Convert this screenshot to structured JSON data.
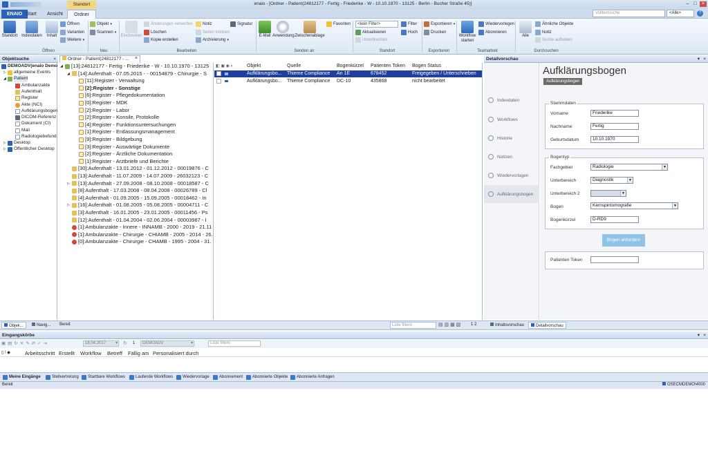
{
  "window": {
    "title": "enaio - [Ordner - Patient(24812177 - Fertig - Friederike - W - 10.10.1970 - 13125 - Berlin - Bucher Straße 45)]",
    "context_tab": "Standort",
    "search_placeholder": "Volltextsuche",
    "scope": "<Alle>"
  },
  "ribbon": {
    "tabs": [
      {
        "label": "ENAIO"
      },
      {
        "label": "Start"
      },
      {
        "label": "Ansicht"
      },
      {
        "label": "Ordner"
      }
    ],
    "groups": {
      "oeffnen": "Öffnen",
      "neu": "Neu",
      "bearbeiten": "Bearbeiten",
      "senden": "Senden an",
      "standort": "Standort",
      "exportieren": "Exportieren",
      "teamarbeit": "Teamarbeit",
      "durchsuchen": "Durchsuchen"
    },
    "btn": {
      "standort": "Standort",
      "indexdaten": "Indexdaten",
      "inhalt": "Inhalt",
      "oeffnen": "Öffnen",
      "varianten": "Varianten",
      "weitere": "Weitere",
      "objekt": "Objekt",
      "scannen": "Scannen",
      "einchecken": "Einchecken",
      "aenderungen": "Änderungen verwerfen",
      "loeschen": "Löschen",
      "kopie": "Kopie erstellen",
      "notiz": "Notiz",
      "seiten": "Seiten trennen",
      "archivierung": "Archivierung",
      "signatur": "Signatur",
      "email": "E-Mail",
      "anwendung": "Anwendung",
      "zwischenablage": "Zwischenablage",
      "favoriten": "Favoriten",
      "filter_combo": "<kein Filter>",
      "aktualisieren": "Aktualisieren",
      "unterbrechen": "Unterbrechen",
      "filter": "Filter",
      "hoch": "Hoch",
      "exportieren": "Exportieren",
      "drucken": "Drucken",
      "workflow": "Workflow starten",
      "wiedervorlegen": "Wiedervorlegen",
      "abonnieren": "Abonnieren",
      "alle": "Alle",
      "aehnliche": "Ähnliche Objekte",
      "notiz2": "Notiz",
      "suche": "Suche aufheben"
    }
  },
  "objektsuche": {
    "title": "Objektsuche",
    "items": [
      {
        "label": "DEMOADV(enaio Demo"
      },
      {
        "label": "allgemeine Events"
      },
      {
        "label": "Patient"
      },
      {
        "label": "Ambulanzakte"
      },
      {
        "label": "Aufenthalt"
      },
      {
        "label": "Register"
      },
      {
        "label": "Akte (NCI)"
      },
      {
        "label": "Aufklärungsbogen"
      },
      {
        "label": "DICOM-Referenz"
      },
      {
        "label": "Dokument (CI)"
      },
      {
        "label": "Mail"
      },
      {
        "label": "Radiologiebefund"
      },
      {
        "label": "Desktop"
      },
      {
        "label": "Öffentlicher Desktop"
      }
    ]
  },
  "folder": {
    "title": "Ordner - Patient(24812177 - ...",
    "rows": [
      {
        "label": "[13]:24812177 - Fertig - Friederike - W - 10.10.1970 - 13125"
      },
      {
        "label": "[14]:Aufenthalt - 07.05.2015 - - 00154879 - Chirurgie - S"
      },
      {
        "label": "[11]:Register - Verwaltung"
      },
      {
        "label": "[2]:Register - Sonstige"
      },
      {
        "label": "[6]:Register - Pflegedokumentation"
      },
      {
        "label": "[0]:Register - MDK"
      },
      {
        "label": "[2]:Register - Labor"
      },
      {
        "label": "[2]:Register - Konsile, Protokolle"
      },
      {
        "label": "[4]:Register - Funktionsuntersuchungen"
      },
      {
        "label": "[1]:Register - Entlassungsmanagement"
      },
      {
        "label": "[9]:Register - Bildgebung"
      },
      {
        "label": "[3]:Register - Auswärtige Dokumente"
      },
      {
        "label": "[2]:Register - Ärztliche Dokumentation"
      },
      {
        "label": "[1]:Register - Arztbriefe und Berichte"
      },
      {
        "label": "[30]:Aufenthalt - 13.01.2012 - 01.12.2012 - 00019876 - C"
      },
      {
        "label": "[13]:Aufenthalt - 11.07.2009 - 14.07.2009 - 26032123 - C"
      },
      {
        "label": "[13]:Aufenthalt - 27.09.2008 - 08.10.2008 - 00018587 - C"
      },
      {
        "label": "[8]:Aufenthalt - 17.03.2008 - 08.04.2008 - 00026789 - Cl"
      },
      {
        "label": "[4]:Aufenthalt - 01.09.2005 - 15.09.2005 - 00018462 - In"
      },
      {
        "label": "[16]:Aufenthalt - 01.08.2005 - 05.08.2005 - 00004711 - C"
      },
      {
        "label": "[3]:Aufenthalt - 16.01.2005 - 23.01.2005 - 00011456 - Ps"
      },
      {
        "label": "[12]:Aufenthalt - 01.04.2004 - 02.06.2004 - 00003987 - I"
      },
      {
        "label": "[1]:Ambulanzakte - Innere - INNAMB - 2000 - 2019 - 21.11"
      },
      {
        "label": "[1]:Ambulanzakte - Chirurgie - CHIAMB - 2005 - 2014 - 26."
      },
      {
        "label": "[0]:Ambulanzakte - Chirurgie - CHAMB - 1995 - 2004 - 31."
      }
    ]
  },
  "table": {
    "headers": [
      "Objekt",
      "Quelle",
      "Bogenkürzel",
      "Patienten Token",
      "Bogen Status"
    ],
    "rows": [
      [
        "Aufklärungsbo...",
        "Thieme Compliance",
        "An 1E",
        "678452",
        "Freigegeben / Unterschrieben"
      ],
      [
        "Aufklärungsbo...",
        "Thieme Compliance",
        "DC-10",
        "435868",
        "nicht bearbeitet"
      ]
    ]
  },
  "detail": {
    "pane_title": "Detailvorschau",
    "heading": "Aufklärungsbogen",
    "tag": "Aufklärungsbogen",
    "nav": [
      "Indexdaten",
      "Workflows",
      "Historie",
      "Notizen",
      "Wiedervorlagen",
      "Aufklärungsbogen"
    ],
    "stammdaten": {
      "legend": "Stammdaten",
      "vorname_label": "Vorname",
      "vorname": "Friederike",
      "nachname_label": "Nachname",
      "nachname": "Fertig",
      "geburt_label": "Geburtsdatum",
      "geburt": "10.10.1970"
    },
    "bogentyp": {
      "legend": "Bogentyp",
      "fach_label": "Fachgebiet",
      "fach": "Radiologie",
      "unter_label": "Unterbereich",
      "unter": "Diagnostik",
      "unter2_label": "Unterbereich 2",
      "unter2": "",
      "bogen_label": "Bogen",
      "bogen": "Kernspintomografie",
      "kuerzel_label": "Bogenkürzel",
      "kuerzel": "D-RD9",
      "anfordern": "Bogen anfordern"
    },
    "token_label": "Patienten Token",
    "token": ""
  },
  "statusmid": {
    "objekt": "Objek...",
    "navig": "Navig...",
    "bereit": "Bereit",
    "filter": "Liste filtern",
    "pages": "1  2",
    "inhalt": "Inhaltsvorschau",
    "detail": "Detailvorschau"
  },
  "eingang": {
    "title": "Eingangskörbe",
    "date": "18.04.2017",
    "user": "DEMOADV",
    "count": "1",
    "filter": "Liste filtern",
    "cols": [
      "Arbeitsschritt",
      "Erstellt",
      "Workflow",
      "Betreff",
      "Fällig am",
      "Personalisiert durch"
    ]
  },
  "bottom_tabs": [
    "Meine Eingänge",
    "Stellvertretung",
    "Startbare Workflows",
    "Laufende Workflows",
    "Wiedervorlage",
    "Abonnement",
    "Abonnierte Objekte",
    "Abonnierte Anfragen"
  ],
  "status": {
    "left": "Bereit",
    "right": "OSECMDEMO\\4000"
  }
}
